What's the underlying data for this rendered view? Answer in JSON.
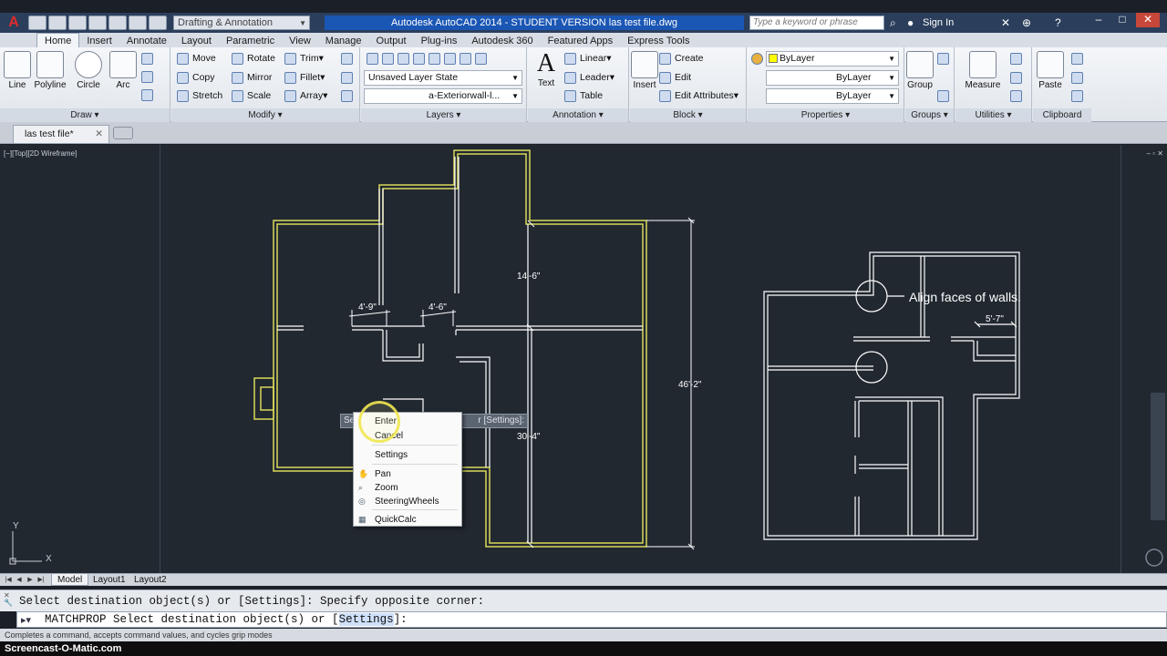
{
  "app": {
    "title": "Autodesk AutoCAD 2014 - STUDENT VERSION     las test file.dwg",
    "workspace": "Drafting & Annotation",
    "search_placeholder": "Type a keyword or phrase",
    "sign_in": "Sign In"
  },
  "ribbon_tabs": [
    "Home",
    "Insert",
    "Annotate",
    "Layout",
    "Parametric",
    "View",
    "Manage",
    "Output",
    "Plug-ins",
    "Autodesk 360",
    "Featured Apps",
    "Express Tools"
  ],
  "draw": {
    "title": "Draw",
    "line": "Line",
    "polyline": "Polyline",
    "circle": "Circle",
    "arc": "Arc"
  },
  "modify": {
    "title": "Modify",
    "move": "Move",
    "rotate": "Rotate",
    "trim": "Trim",
    "copy": "Copy",
    "mirror": "Mirror",
    "fillet": "Fillet",
    "stretch": "Stretch",
    "scale": "Scale",
    "array": "Array"
  },
  "layers": {
    "title": "Layers",
    "layer_state": "Unsaved Layer State",
    "current_layer": "a-Exteriorwall-l..."
  },
  "annotation": {
    "title": "Annotation",
    "text": "Text",
    "linear": "Linear",
    "leader": "Leader",
    "table": "Table"
  },
  "block": {
    "title": "Block",
    "insert": "Insert",
    "create": "Create",
    "edit": "Edit",
    "edit_attributes": "Edit Attributes"
  },
  "properties": {
    "title": "Properties",
    "color": "ByLayer",
    "linetype": "ByLayer",
    "lineweight": "ByLayer"
  },
  "groups": {
    "title": "Groups",
    "group": "Group"
  },
  "utilities": {
    "title": "Utilities",
    "measure": "Measure"
  },
  "clipboard": {
    "title": "Clipboard",
    "paste": "Paste"
  },
  "file_tab": "las test file*",
  "viewport_label": "[−][Top][2D Wireframe]",
  "drawing": {
    "dim_14_6": "14'-6\"",
    "dim_4_9": "4'-9\"",
    "dim_4_6": "4'-6\"",
    "dim_46_2": "46'-2\"",
    "dim_30_4": "30'-4\"",
    "dim_5_7": "5'-7\"",
    "annotation": "Align faces of walls.",
    "y_axis": "Y",
    "x_axis": "X"
  },
  "command_prompt_bar": {
    "left": "Se",
    "right": "r [Settings]:"
  },
  "context_menu": [
    "Enter",
    "Cancel",
    "Settings",
    "Pan",
    "Zoom",
    "SteeringWheels",
    "QuickCalc"
  ],
  "layout_tabs": [
    "Model",
    "Layout1",
    "Layout2"
  ],
  "command": {
    "history": "Select destination object(s) or [Settings]: Specify opposite corner:",
    "current_prefix": "MATCHPROP Select destination object(s) or [",
    "current_option": "Settings",
    "current_suffix": "]:"
  },
  "status_text": "Completes a command, accepts command values, and cycles grip modes",
  "watermark": "Screencast-O-Matic.com",
  "colors": {
    "accent": "#1a56b4",
    "wall_highlight": "#d9d85a",
    "wall": "#ffffff",
    "canvas": "#212830"
  }
}
